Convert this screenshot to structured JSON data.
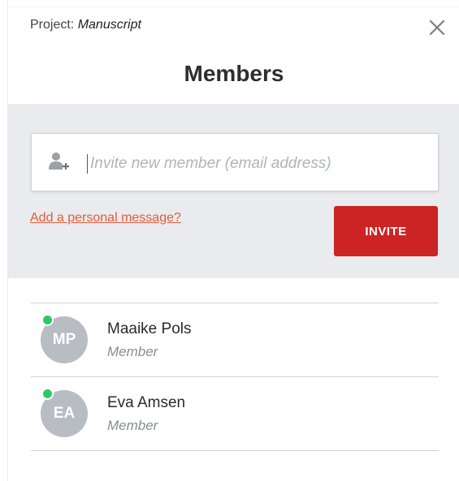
{
  "header": {
    "project_prefix": "Project:",
    "project_name": "Manuscript",
    "title": "Members"
  },
  "invite": {
    "placeholder": "Invite new member (email address)",
    "personal_message_link": "Add a personal message?",
    "invite_button": "INVITE"
  },
  "members": [
    {
      "initials": "MP",
      "name": "Maaike Pols",
      "role": "Member",
      "online": true
    },
    {
      "initials": "EA",
      "name": "Eva Amsen",
      "role": "Member",
      "online": true
    }
  ],
  "colors": {
    "invite_button": "#cc2424",
    "link": "#e25c3a",
    "online": "#2ec866",
    "avatar": "#b8bdc4",
    "invite_section_bg": "#e9ebee"
  },
  "icons": [
    "close-icon",
    "user-add-icon"
  ]
}
